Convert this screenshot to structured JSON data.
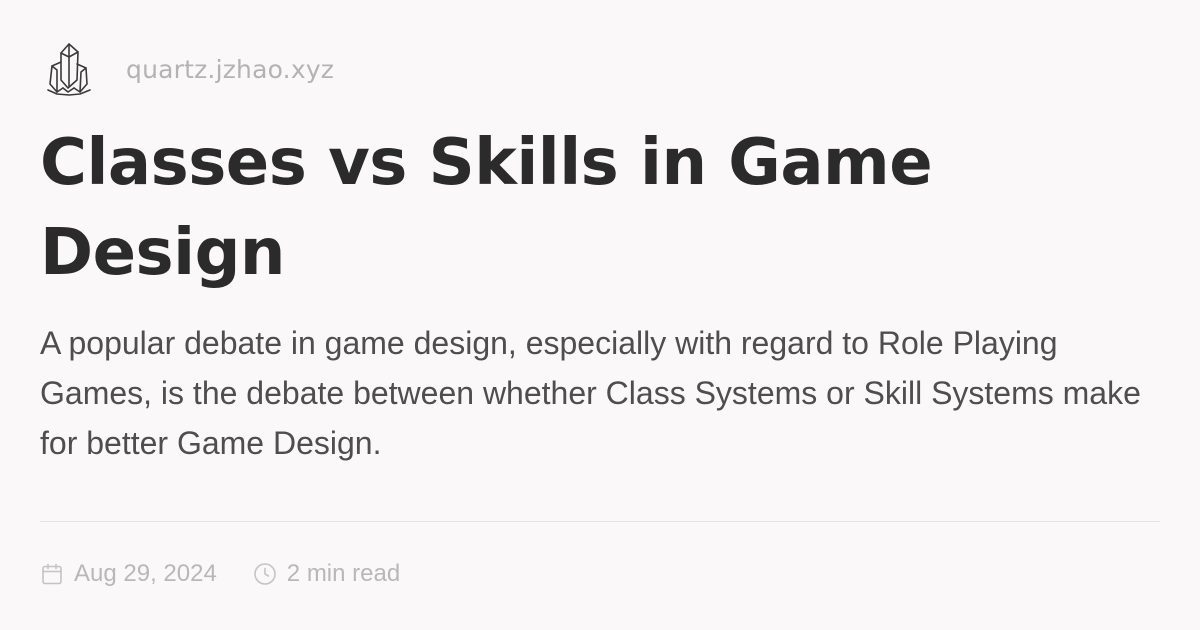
{
  "site": {
    "name": "quartz.jzhao.xyz",
    "logo_icon": "crystal-cluster-icon"
  },
  "article": {
    "title": "Classes vs Skills in Game Design",
    "description": "A popular debate in game design, especially with regard to Role Playing Games, is the debate between whether Class Systems or Skill Systems make for better Game Design."
  },
  "meta": {
    "date": "Aug 29, 2024",
    "date_icon": "calendar-icon",
    "read_time": "2 min read",
    "read_time_icon": "clock-icon"
  },
  "colors": {
    "background": "#faf8f8",
    "title": "#2b2b2b",
    "description": "#4e4e4e",
    "muted": "#b3b3b3",
    "divider": "#e6e3e3"
  }
}
